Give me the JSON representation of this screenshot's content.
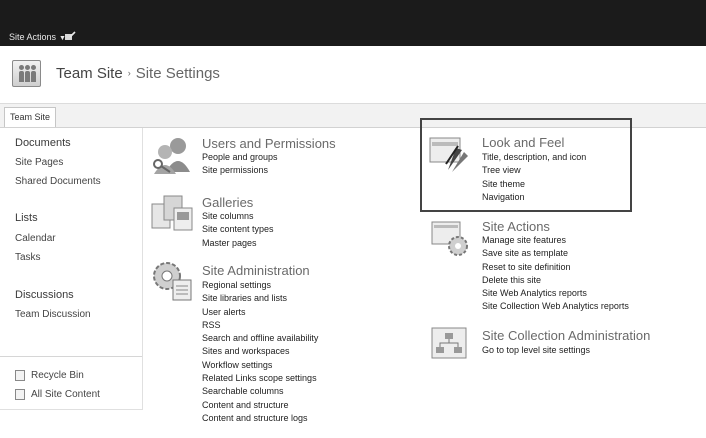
{
  "topbar": {
    "site_actions": "Site Actions",
    "edit_icon": "edit-page-icon"
  },
  "header": {
    "site_name": "Team Site",
    "separator": "›",
    "page_title": "Site Settings"
  },
  "topnav": {
    "tab": "Team Site"
  },
  "quicklaunch": {
    "documents": "Documents",
    "site_pages": "Site Pages",
    "shared_documents": "Shared Documents",
    "lists": "Lists",
    "calendar": "Calendar",
    "tasks": "Tasks",
    "discussions": "Discussions",
    "team_discussion": "Team Discussion",
    "recycle_bin": "Recycle Bin",
    "all_site_content": "All Site Content"
  },
  "sections": {
    "users": {
      "title": "Users and Permissions",
      "links": [
        "People and groups",
        "Site permissions"
      ]
    },
    "galleries": {
      "title": "Galleries",
      "links": [
        "Site columns",
        "Site content types",
        "Master pages"
      ]
    },
    "site_admin": {
      "title": "Site Administration",
      "links": [
        "Regional settings",
        "Site libraries and lists",
        "User alerts",
        "RSS",
        "Search and offline availability",
        "Sites and workspaces",
        "Workflow settings",
        "Related Links scope settings",
        "Searchable columns",
        "Content and structure",
        "Content and structure logs"
      ]
    },
    "look_feel": {
      "title": "Look and Feel",
      "links": [
        "Title, description, and icon",
        "Tree view",
        "Site theme",
        "Navigation"
      ]
    },
    "site_actions": {
      "title": "Site Actions",
      "links": [
        "Manage site features",
        "Save site as template",
        "Reset to site definition",
        "Delete this site",
        "Site Web Analytics reports",
        "Site Collection Web Analytics reports"
      ]
    },
    "site_collection_admin": {
      "title": "Site Collection Administration",
      "links": [
        "Go to top level site settings"
      ]
    }
  }
}
